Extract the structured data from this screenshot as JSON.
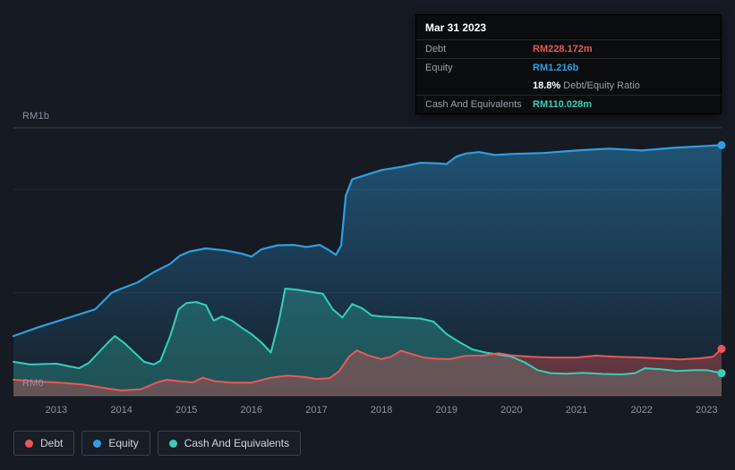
{
  "colors": {
    "background": "#151a23",
    "debt": "#eb5757",
    "equity": "#2f9fe0",
    "cash": "#35d0ba",
    "grid_strong": "#39424f",
    "grid_faint": "#222a35",
    "axis_text": "#8a94a4",
    "tooltip_bg": "#0b0c0e",
    "tooltip_border": "#26282c",
    "text_muted": "#9aa0a8",
    "text": "#ffffff"
  },
  "axis": {
    "y_top": "RM1b",
    "y_bottom": "RM0"
  },
  "tooltip": {
    "date": "Mar 31 2023",
    "debt_label": "Debt",
    "debt_value": "RM228.172m",
    "equity_label": "Equity",
    "equity_value": "RM1.216b",
    "ratio_value": "18.8%",
    "ratio_label": "Debt/Equity Ratio",
    "cash_label": "Cash And Equivalents",
    "cash_value": "RM110.028m"
  },
  "legend": {
    "items": [
      {
        "label": "Debt",
        "color": "#eb5757"
      },
      {
        "label": "Equity",
        "color": "#2f9fe0"
      },
      {
        "label": "Cash And Equivalents",
        "color": "#35d0ba"
      }
    ]
  },
  "chart_data": {
    "type": "area",
    "values_unit": "RM billions",
    "x_axis": {
      "range": [
        2012.34,
        2023.23
      ],
      "ticks": [
        "2013",
        "2014",
        "2015",
        "2016",
        "2017",
        "2018",
        "2019",
        "2020",
        "2021",
        "2022",
        "2023"
      ]
    },
    "y_axis": {
      "range": [
        0,
        1.3
      ],
      "gridlines": [
        0,
        0.5,
        1.0,
        1.3
      ],
      "labels": [
        "RM1b",
        "RM0"
      ]
    },
    "legend_position": "bottom-left",
    "series": [
      {
        "name": "Equity",
        "color": "#2f9fe0",
        "end_value_label": "RM1.216b",
        "points": [
          [
            2012.34,
            0.29
          ],
          [
            2012.7,
            0.33
          ],
          [
            2013.0,
            0.36
          ],
          [
            2013.3,
            0.39
          ],
          [
            2013.6,
            0.42
          ],
          [
            2013.85,
            0.5
          ],
          [
            2014.0,
            0.52
          ],
          [
            2014.25,
            0.55
          ],
          [
            2014.5,
            0.6
          ],
          [
            2014.75,
            0.64
          ],
          [
            2014.9,
            0.68
          ],
          [
            2015.05,
            0.7
          ],
          [
            2015.3,
            0.715
          ],
          [
            2015.6,
            0.705
          ],
          [
            2015.85,
            0.69
          ],
          [
            2016.0,
            0.675
          ],
          [
            2016.15,
            0.71
          ],
          [
            2016.4,
            0.73
          ],
          [
            2016.65,
            0.732
          ],
          [
            2016.85,
            0.722
          ],
          [
            2017.05,
            0.732
          ],
          [
            2017.2,
            0.705
          ],
          [
            2017.3,
            0.684
          ],
          [
            2017.38,
            0.73
          ],
          [
            2017.45,
            0.97
          ],
          [
            2017.55,
            1.05
          ],
          [
            2017.7,
            1.065
          ],
          [
            2018.0,
            1.095
          ],
          [
            2018.3,
            1.11
          ],
          [
            2018.6,
            1.13
          ],
          [
            2018.85,
            1.128
          ],
          [
            2019.0,
            1.124
          ],
          [
            2019.15,
            1.16
          ],
          [
            2019.3,
            1.175
          ],
          [
            2019.5,
            1.182
          ],
          [
            2019.75,
            1.168
          ],
          [
            2020.0,
            1.173
          ],
          [
            2020.5,
            1.178
          ],
          [
            2021.0,
            1.19
          ],
          [
            2021.5,
            1.199
          ],
          [
            2022.0,
            1.19
          ],
          [
            2022.5,
            1.203
          ],
          [
            2023.0,
            1.212
          ],
          [
            2023.23,
            1.216
          ]
        ]
      },
      {
        "name": "Cash And Equivalents",
        "color": "#35d0ba",
        "end_value_label": "RM110.028m",
        "points": [
          [
            2012.34,
            0.165
          ],
          [
            2012.6,
            0.152
          ],
          [
            2013.0,
            0.156
          ],
          [
            2013.2,
            0.143
          ],
          [
            2013.35,
            0.134
          ],
          [
            2013.5,
            0.16
          ],
          [
            2013.65,
            0.21
          ],
          [
            2013.8,
            0.26
          ],
          [
            2013.9,
            0.29
          ],
          [
            2014.05,
            0.255
          ],
          [
            2014.2,
            0.21
          ],
          [
            2014.35,
            0.165
          ],
          [
            2014.5,
            0.152
          ],
          [
            2014.6,
            0.17
          ],
          [
            2014.75,
            0.29
          ],
          [
            2014.88,
            0.42
          ],
          [
            2015.0,
            0.45
          ],
          [
            2015.15,
            0.455
          ],
          [
            2015.3,
            0.44
          ],
          [
            2015.42,
            0.365
          ],
          [
            2015.55,
            0.385
          ],
          [
            2015.7,
            0.365
          ],
          [
            2015.85,
            0.33
          ],
          [
            2016.0,
            0.3
          ],
          [
            2016.15,
            0.26
          ],
          [
            2016.3,
            0.21
          ],
          [
            2016.42,
            0.36
          ],
          [
            2016.52,
            0.52
          ],
          [
            2016.7,
            0.515
          ],
          [
            2016.9,
            0.505
          ],
          [
            2017.1,
            0.495
          ],
          [
            2017.25,
            0.42
          ],
          [
            2017.4,
            0.38
          ],
          [
            2017.55,
            0.445
          ],
          [
            2017.7,
            0.425
          ],
          [
            2017.85,
            0.39
          ],
          [
            2018.0,
            0.385
          ],
          [
            2018.3,
            0.38
          ],
          [
            2018.6,
            0.375
          ],
          [
            2018.8,
            0.36
          ],
          [
            2019.0,
            0.3
          ],
          [
            2019.2,
            0.26
          ],
          [
            2019.4,
            0.225
          ],
          [
            2019.6,
            0.21
          ],
          [
            2019.8,
            0.2
          ],
          [
            2020.0,
            0.19
          ],
          [
            2020.2,
            0.163
          ],
          [
            2020.4,
            0.125
          ],
          [
            2020.6,
            0.11
          ],
          [
            2020.85,
            0.107
          ],
          [
            2021.1,
            0.112
          ],
          [
            2021.4,
            0.106
          ],
          [
            2021.7,
            0.104
          ],
          [
            2021.9,
            0.11
          ],
          [
            2022.05,
            0.134
          ],
          [
            2022.3,
            0.129
          ],
          [
            2022.55,
            0.12
          ],
          [
            2022.8,
            0.125
          ],
          [
            2023.0,
            0.125
          ],
          [
            2023.23,
            0.11
          ]
        ]
      },
      {
        "name": "Debt",
        "color": "#eb5757",
        "end_value_label": "RM228.172m",
        "points": [
          [
            2012.34,
            0.078
          ],
          [
            2012.8,
            0.068
          ],
          [
            2013.0,
            0.065
          ],
          [
            2013.4,
            0.055
          ],
          [
            2013.8,
            0.035
          ],
          [
            2014.0,
            0.026
          ],
          [
            2014.3,
            0.032
          ],
          [
            2014.55,
            0.065
          ],
          [
            2014.7,
            0.078
          ],
          [
            2014.9,
            0.07
          ],
          [
            2015.1,
            0.065
          ],
          [
            2015.25,
            0.088
          ],
          [
            2015.45,
            0.07
          ],
          [
            2015.7,
            0.064
          ],
          [
            2016.0,
            0.064
          ],
          [
            2016.3,
            0.088
          ],
          [
            2016.55,
            0.098
          ],
          [
            2016.8,
            0.092
          ],
          [
            2017.0,
            0.082
          ],
          [
            2017.2,
            0.085
          ],
          [
            2017.35,
            0.12
          ],
          [
            2017.5,
            0.19
          ],
          [
            2017.62,
            0.22
          ],
          [
            2017.8,
            0.196
          ],
          [
            2018.0,
            0.178
          ],
          [
            2018.15,
            0.19
          ],
          [
            2018.3,
            0.219
          ],
          [
            2018.45,
            0.204
          ],
          [
            2018.65,
            0.186
          ],
          [
            2018.85,
            0.18
          ],
          [
            2019.05,
            0.178
          ],
          [
            2019.3,
            0.194
          ],
          [
            2019.55,
            0.195
          ],
          [
            2019.8,
            0.207
          ],
          [
            2020.0,
            0.196
          ],
          [
            2020.3,
            0.19
          ],
          [
            2020.6,
            0.186
          ],
          [
            2021.0,
            0.186
          ],
          [
            2021.3,
            0.195
          ],
          [
            2021.6,
            0.19
          ],
          [
            2022.0,
            0.186
          ],
          [
            2022.3,
            0.181
          ],
          [
            2022.6,
            0.177
          ],
          [
            2022.9,
            0.182
          ],
          [
            2023.1,
            0.19
          ],
          [
            2023.23,
            0.228
          ]
        ]
      }
    ]
  }
}
